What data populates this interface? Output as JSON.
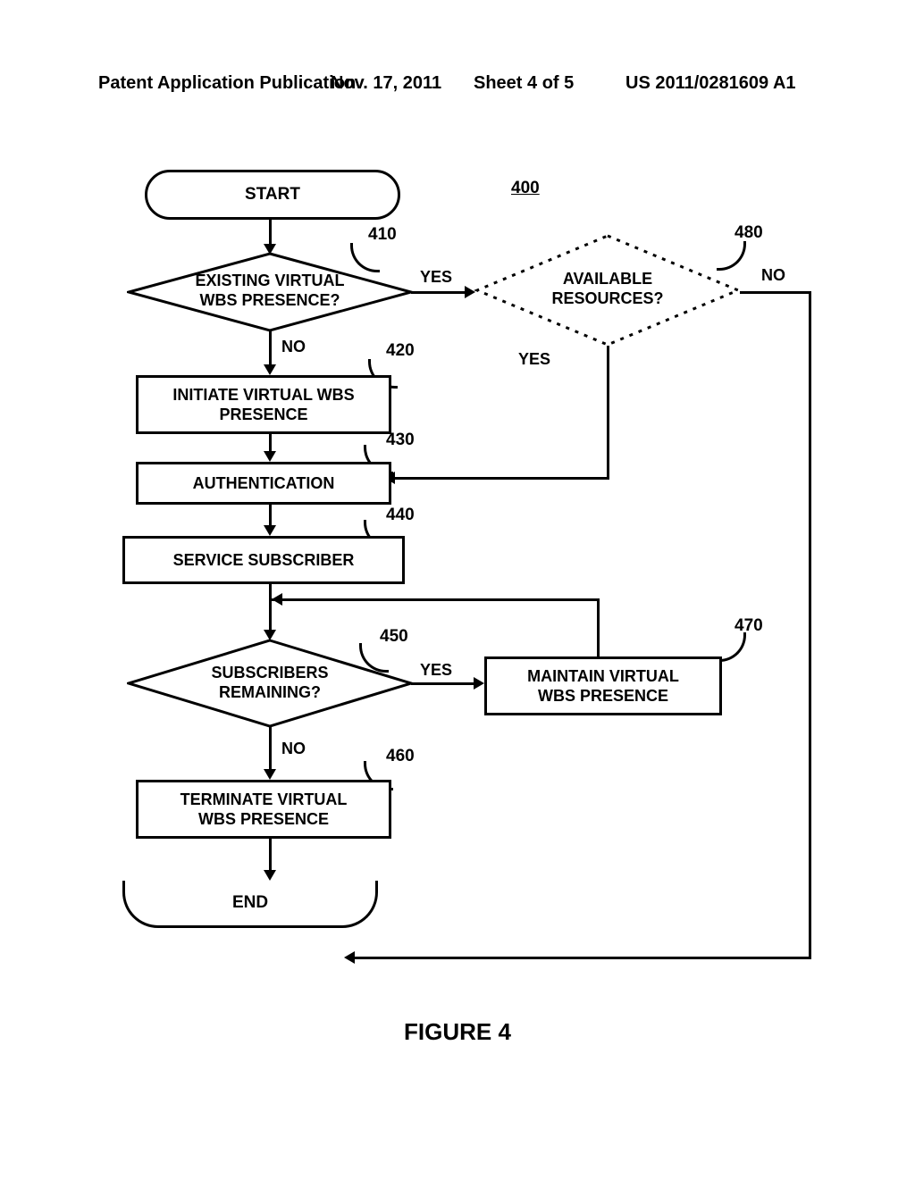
{
  "header": {
    "left": "Patent Application Publication",
    "date": "Nov. 17, 2011",
    "sheet": "Sheet 4 of 5",
    "pubno": "US 2011/0281609 A1"
  },
  "caption": "FIGURE 4",
  "nodes": {
    "start": "START",
    "end": "END",
    "d410": "EXISTING VIRTUAL\nWBS PRESENCE?",
    "p420": "INITIATE VIRTUAL WBS\nPRESENCE",
    "p430": "AUTHENTICATION",
    "p440": "SERVICE SUBSCRIBER",
    "d450": "SUBSCRIBERS\nREMAINING?",
    "p460": "TERMINATE VIRTUAL\nWBS PRESENCE",
    "p470": "MAINTAIN VIRTUAL\nWBS PRESENCE",
    "d480": "AVAILABLE\nRESOURCES?"
  },
  "refs": {
    "r400": "400",
    "r410": "410",
    "r420": "420",
    "r430": "430",
    "r440": "440",
    "r450": "450",
    "r460": "460",
    "r470": "470",
    "r480": "480"
  },
  "branches": {
    "yes": "YES",
    "no": "NO"
  }
}
